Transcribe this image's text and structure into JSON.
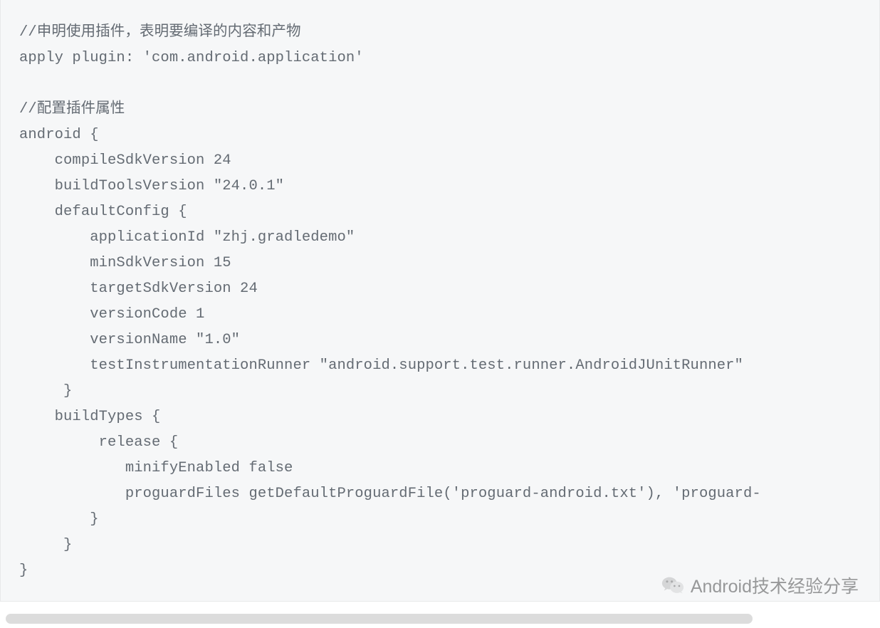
{
  "code": {
    "lines": [
      "//申明使用插件，表明要编译的内容和产物",
      "apply plugin: 'com.android.application'",
      "",
      "//配置插件属性",
      "android {",
      "    compileSdkVersion 24",
      "    buildToolsVersion \"24.0.1\"",
      "    defaultConfig {",
      "        applicationId \"zhj.gradledemo\"",
      "        minSdkVersion 15",
      "        targetSdkVersion 24",
      "        versionCode 1",
      "        versionName \"1.0\"",
      "        testInstrumentationRunner \"android.support.test.runner.AndroidJUnitRunner\"",
      "     }",
      "    buildTypes {",
      "         release {",
      "            minifyEnabled false",
      "            proguardFiles getDefaultProguardFile('proguard-android.txt'), 'proguard-",
      "        }",
      "     }",
      "}"
    ]
  },
  "watermark": {
    "text": "Android技术经验分享"
  }
}
